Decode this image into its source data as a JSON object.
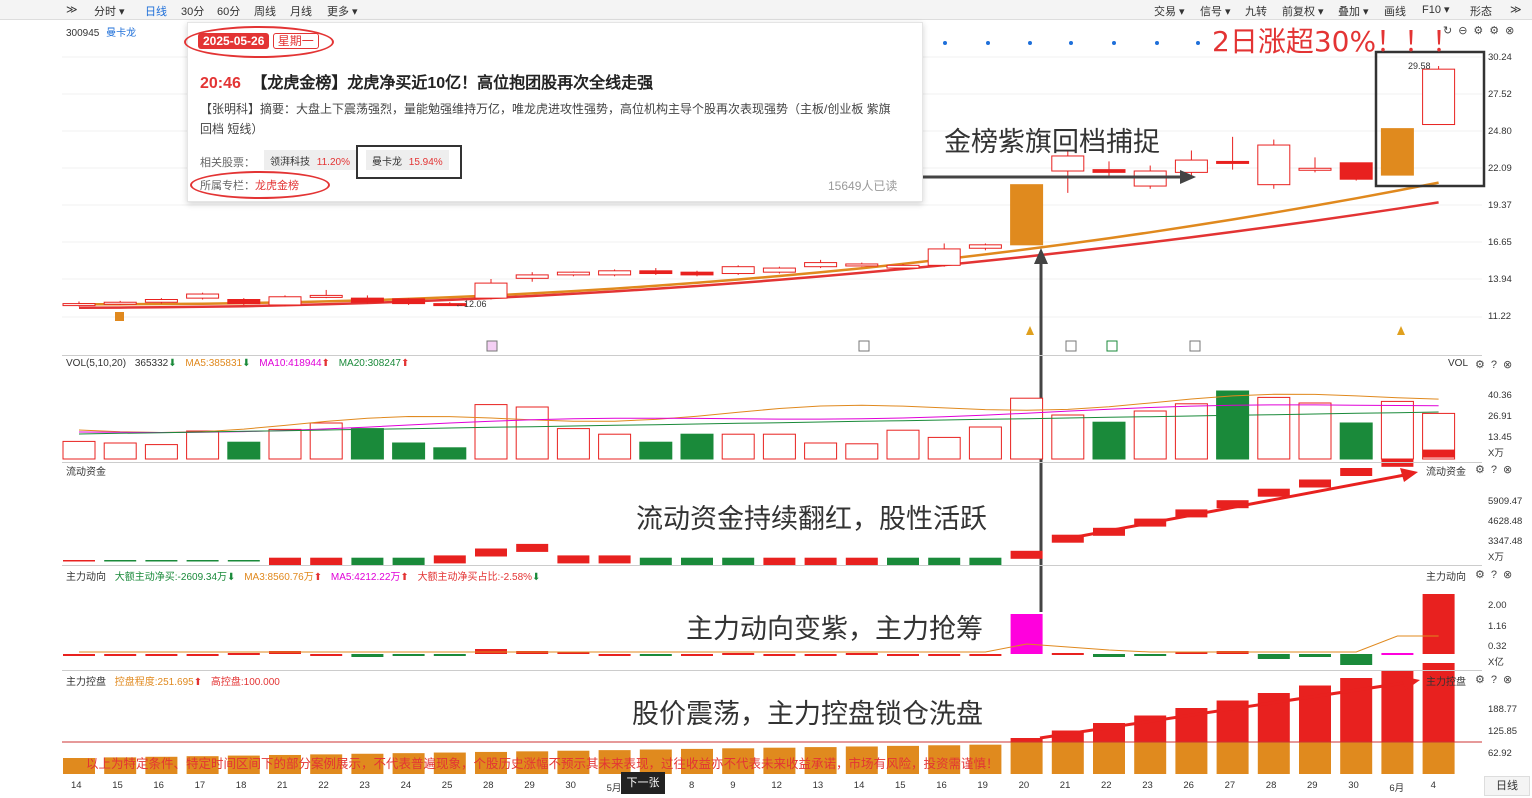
{
  "toolbar": {
    "left_icon": "double-chevron-icon",
    "tabs": [
      "分时 ▾",
      "日线",
      "30分",
      "60分",
      "周线",
      "月线",
      "更多 ▾"
    ],
    "active_tab": "日线",
    "right_items": [
      "交易 ▾",
      "信号 ▾",
      "九转",
      "前复权 ▾",
      "叠加 ▾",
      "画线",
      "F10 ▾",
      "形态"
    ],
    "right_icon": "double-chevron-right-icon"
  },
  "stock": {
    "code": "300945",
    "name": "曼卡龙",
    "name_color": "#1e6fd9"
  },
  "news": {
    "date": "2025-05-26",
    "weekday": "星期一",
    "time": "20:46",
    "headline": "【龙虎金榜】龙虎净买近10亿！高位抱团股再次全线走强",
    "summary": "【张明科】摘要：大盘上下震荡强烈，量能勉强维持万亿，唯龙虎进攻性强势，高位机构主导个股再次表现强势（主板/创业板 紫旗回档 短线）",
    "related_label": "相关股票：",
    "related": [
      {
        "name": "领湃科技",
        "change": "11.20%"
      },
      {
        "name": "曼卡龙",
        "change": "15.94%"
      }
    ],
    "column_label": "所属专栏：",
    "column_name": "龙虎金榜",
    "reads": "15649人已读"
  },
  "annotations": {
    "headline_red": "2日涨超30%！！！",
    "gold_flag": "金榜紫旗回档捕捉",
    "liquidity": "流动资金持续翻红，股性活跃",
    "main_direction": "主力动向变紫，主力抢筹",
    "main_control": "股价震荡，主力控盘锁仓洗盘",
    "peak_label": "29.58",
    "low_label": "12.06",
    "disclaimer": "以上为特定条件、特定时间区间下的部分案例展示，不代表普遍现象，个股历史涨幅不预示其未来表现，过往收益亦不代表未来收益承诺，市场有风险，投资需谨慎！",
    "next_button": "下一张"
  },
  "panels": {
    "price_axis": [
      "30.24",
      "27.52",
      "24.80",
      "22.09",
      "19.37",
      "16.65",
      "13.94",
      "11.22"
    ],
    "vol": {
      "title": "VOL(5,10,20)",
      "value": "365332",
      "ma5": "MA5:385831",
      "ma10": "MA10:418944",
      "ma20": "MA20:308247",
      "right_label": "VOL",
      "axis": [
        "40.36",
        "26.91",
        "13.45"
      ],
      "unit": "X万"
    },
    "liquidity": {
      "title": "流动资金",
      "right_label": "流动资金",
      "axis": [
        "5909.47",
        "4628.48",
        "3347.48"
      ],
      "unit": "X万"
    },
    "direction": {
      "title": "主力动向",
      "net": "大额主动净买:-2609.34万",
      "ma3": "MA3:8560.76万",
      "ma5": "MA5:4212.22万",
      "ratio": "大额主动净买占比:-2.58%",
      "right_label": "主力动向",
      "axis": [
        "2.00",
        "1.16",
        "0.32"
      ],
      "unit": "X亿"
    },
    "control": {
      "title": "主力控盘",
      "degree": "控盘程度:251.695",
      "high": "高控盘:100.000",
      "right_label": "主力控盘",
      "axis": [
        "188.77",
        "125.85",
        "62.92"
      ]
    }
  },
  "x_axis": [
    "14",
    "15",
    "16",
    "17",
    "18",
    "21",
    "22",
    "23",
    "24",
    "25",
    "28",
    "29",
    "30",
    "5月",
    "7",
    "8",
    "9",
    "12",
    "13",
    "14",
    "15",
    "16",
    "19",
    "20",
    "21",
    "22",
    "23",
    "26",
    "27",
    "28",
    "29",
    "30",
    "6月",
    "4"
  ],
  "period_label": "日线",
  "candles": [
    [
      12.15,
      12.2,
      12.0,
      12.35
    ],
    [
      12.25,
      12.3,
      12.1,
      12.4
    ],
    [
      12.3,
      12.5,
      12.2,
      12.6
    ],
    [
      12.6,
      12.9,
      12.5,
      13.0
    ],
    [
      12.5,
      12.2,
      12.1,
      12.6
    ],
    [
      12.1,
      12.7,
      12.0,
      12.8
    ],
    [
      12.75,
      12.8,
      12.6,
      13.2
    ],
    [
      12.6,
      12.3,
      12.2,
      12.8
    ],
    [
      12.55,
      12.2,
      12.1,
      12.6
    ],
    [
      12.2,
      12.15,
      12.06,
      12.3
    ],
    [
      12.6,
      13.7,
      12.5,
      14.0
    ],
    [
      14.05,
      14.3,
      13.8,
      14.5
    ],
    [
      14.3,
      14.5,
      14.2,
      14.55
    ],
    [
      14.3,
      14.6,
      14.2,
      14.7
    ],
    [
      14.6,
      14.4,
      14.3,
      14.8
    ],
    [
      14.5,
      14.3,
      14.2,
      14.6
    ],
    [
      14.4,
      14.9,
      14.3,
      15.0
    ],
    [
      14.5,
      14.8,
      14.4,
      14.9
    ],
    [
      14.9,
      15.2,
      14.8,
      15.4
    ],
    [
      15.0,
      15.1,
      14.9,
      15.2
    ],
    [
      14.8,
      15.0,
      14.7,
      15.1
    ],
    [
      15.0,
      16.2,
      14.9,
      16.6
    ],
    [
      16.25,
      16.5,
      16.1,
      16.6
    ],
    [
      16.5,
      20.9,
      16.5,
      20.9
    ],
    [
      21.9,
      23.0,
      20.3,
      23.4
    ],
    [
      22.0,
      21.8,
      21.5,
      22.6
    ],
    [
      20.8,
      21.9,
      20.6,
      22.3
    ],
    [
      21.8,
      22.7,
      21.5,
      23.4
    ],
    [
      22.6,
      22.5,
      22.0,
      24.4
    ],
    [
      20.9,
      23.8,
      20.6,
      24.2
    ],
    [
      22.1,
      22.1,
      21.8,
      22.9
    ],
    [
      22.5,
      21.3,
      21.2,
      22.5
    ],
    [
      21.6,
      25.0,
      21.6,
      25.0
    ],
    [
      25.3,
      29.35,
      25.3,
      29.58
    ]
  ],
  "colors": {
    "up": "#e8211f",
    "down": "#1a8a3a",
    "ma_short": "#e0891e",
    "ma_long": "#e33434",
    "purple": "#ff00dd",
    "gold": "#e08a1e"
  }
}
